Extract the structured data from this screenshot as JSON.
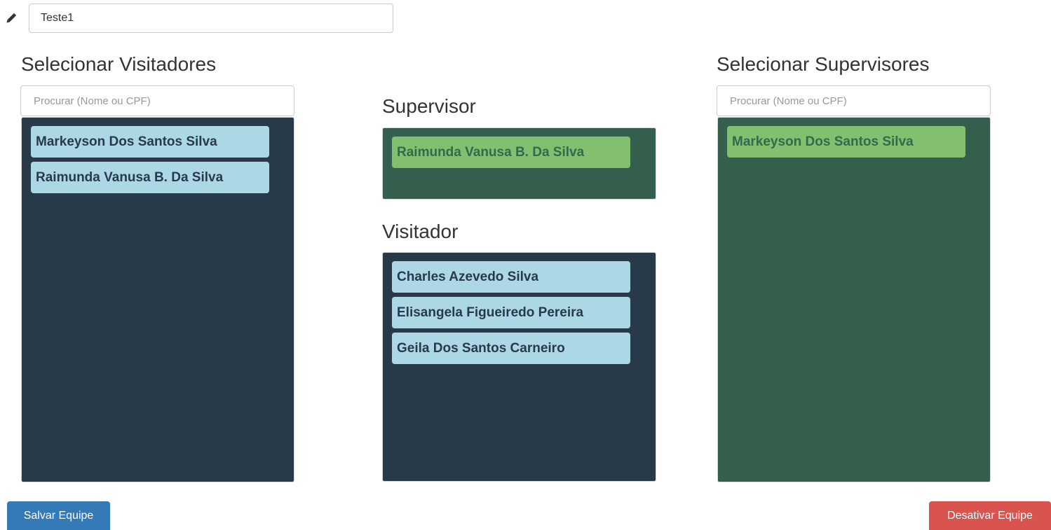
{
  "team": {
    "name_value": "Teste1"
  },
  "visitors_selector": {
    "heading": "Selecionar Visitadores",
    "search_placeholder": "Procurar (Nome ou CPF)",
    "items": [
      {
        "label": "Markeyson Dos Santos Silva"
      },
      {
        "label": "Raimunda Vanusa B. Da Silva"
      }
    ]
  },
  "supervisor_slot": {
    "heading": "Supervisor",
    "items": [
      {
        "label": "Raimunda Vanusa B. Da Silva"
      }
    ]
  },
  "visitor_slot": {
    "heading": "Visitador",
    "items": [
      {
        "label": "Charles Azevedo Silva"
      },
      {
        "label": "Elisangela Figueiredo Pereira"
      },
      {
        "label": "Geila Dos Santos Carneiro"
      }
    ]
  },
  "supervisors_selector": {
    "heading": "Selecionar Supervisores",
    "search_placeholder": "Procurar (Nome ou CPF)",
    "items": [
      {
        "label": "Markeyson Dos Santos Silva"
      }
    ]
  },
  "actions": {
    "save_label": "Salvar Equipe",
    "deactivate_label": "Desativar Equipe"
  },
  "icons": {
    "edit": "pencil-icon"
  },
  "colors": {
    "dark_panel": "#283a4a",
    "green_panel": "#355f4d",
    "blue_item": "#acd8e6",
    "green_item": "#82c06f",
    "primary": "#337ab7",
    "danger": "#d9534f"
  }
}
